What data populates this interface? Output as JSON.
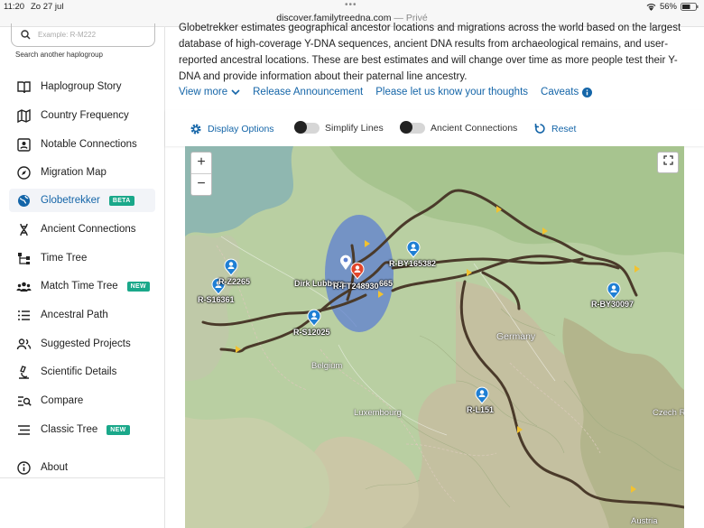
{
  "status": {
    "time": "11:20",
    "date": "Zo 27 jul",
    "battery": "56%"
  },
  "url": {
    "domain": "discover.familytreedna.com",
    "suffix": "— Privé"
  },
  "search": {
    "placeholder": "Example: R-M222",
    "hint": "Search another haplogroup"
  },
  "nav": [
    {
      "label": "Haplogroup Story",
      "icon": "book-icon"
    },
    {
      "label": "Country Frequency",
      "icon": "map-icon"
    },
    {
      "label": "Notable Connections",
      "icon": "id-card-icon"
    },
    {
      "label": "Migration Map",
      "icon": "compass-icon"
    },
    {
      "label": "Globetrekker",
      "icon": "globe-icon",
      "badge": "BETA",
      "active": true
    },
    {
      "label": "Ancient Connections",
      "icon": "dna-icon"
    },
    {
      "label": "Time Tree",
      "icon": "tree-icon"
    },
    {
      "label": "Match Time Tree",
      "icon": "group-icon",
      "badge": "NEW"
    },
    {
      "label": "Ancestral Path",
      "icon": "list-icon"
    },
    {
      "label": "Suggested Projects",
      "icon": "people-icon"
    },
    {
      "label": "Scientific Details",
      "icon": "microscope-icon"
    },
    {
      "label": "Compare",
      "icon": "compare-icon"
    },
    {
      "label": "Classic Tree",
      "icon": "lines-icon",
      "badge": "NEW"
    },
    {
      "label": "About",
      "icon": "info-icon"
    }
  ],
  "intro": "Globetrekker estimates geographical ancestor locations and migrations across the world based on the largest database of high-coverage Y-DNA sequences, ancient DNA results from archaeological remains, and user-reported ancestral locations. These are best estimates and will change over time as more people test their Y-DNA and provide information about their paternal line ancestry.",
  "links": {
    "view_more": "View more",
    "release": "Release Announcement",
    "thoughts": "Please let us know your thoughts",
    "caveats": "Caveats"
  },
  "toolbar": {
    "display": "Display Options",
    "simplify": "Simplify Lines",
    "ancient": "Ancient Connections",
    "reset": "Reset"
  },
  "map": {
    "zoom_in": "+",
    "zoom_out": "−",
    "markers": [
      "R-Z2265",
      "R-S16361",
      "R-BY165382",
      "R-FT248930",
      "Dirk Lubbers",
      "665",
      "R-S12025",
      "R-BY30097",
      "R-L151"
    ],
    "countries": [
      "Germany",
      "Belgium",
      "Luxembourg",
      "Czech R",
      "Austria"
    ]
  },
  "colors": {
    "accent": "#1465a8",
    "badge": "#1aa88a",
    "route": "#4a3a2a"
  }
}
